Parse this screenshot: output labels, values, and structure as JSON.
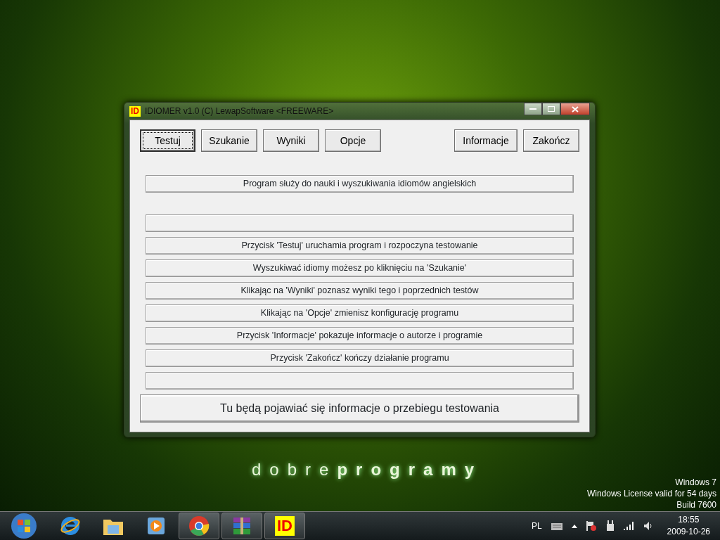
{
  "desktop": {
    "wallpaper_logo": {
      "light": "dobre",
      "bold": "programy"
    },
    "os_notice": [
      "Windows 7",
      "Windows License valid for 54 days",
      "Build 7600"
    ]
  },
  "window": {
    "title": "IDIOMER v1.0 (C) LewapSoftware <FREEWARE>",
    "app_badge": "ID",
    "left_buttons": [
      {
        "label": "Testuj",
        "focused": true
      },
      {
        "label": "Szukanie",
        "focused": false
      },
      {
        "label": "Wyniki",
        "focused": false
      },
      {
        "label": "Opcje",
        "focused": false
      }
    ],
    "right_buttons": [
      {
        "label": "Informacje",
        "focused": false
      },
      {
        "label": "Zakończ",
        "focused": false
      }
    ],
    "headline": "Program służy do nauki i wyszukiwania idiomów angielskich",
    "info_rows": [
      {
        "kind": "blank"
      },
      {
        "kind": "text",
        "text": "Przycisk 'Testuj' uruchamia program i rozpoczyna testowanie"
      },
      {
        "kind": "text",
        "text": "Wyszukiwać idiomy możesz po kliknięciu na 'Szukanie'"
      },
      {
        "kind": "text",
        "text": "Klikając na 'Wyniki' poznasz wyniki tego i poprzednich testów"
      },
      {
        "kind": "text",
        "text": "Klikając na 'Opcje' zmienisz konfigurację programu"
      },
      {
        "kind": "text",
        "text": "Przycisk 'Informacje' pokazuje informacje o autorze i programie"
      },
      {
        "kind": "text",
        "text": "Przycisk 'Zakończ' kończy działanie programu"
      },
      {
        "kind": "blank"
      }
    ],
    "status": "Tu będą pojawiać się informacje o przebiegu testowania"
  },
  "taskbar": {
    "apps": [
      {
        "kind": "ie",
        "running": false
      },
      {
        "kind": "folder",
        "running": false
      },
      {
        "kind": "media",
        "running": false
      },
      {
        "kind": "chrome",
        "running": true
      },
      {
        "kind": "archive",
        "running": true
      },
      {
        "kind": "idiomer",
        "running": true,
        "label": "ID"
      }
    ],
    "language": "PL",
    "time": "18:55",
    "date": "2009-10-26"
  }
}
